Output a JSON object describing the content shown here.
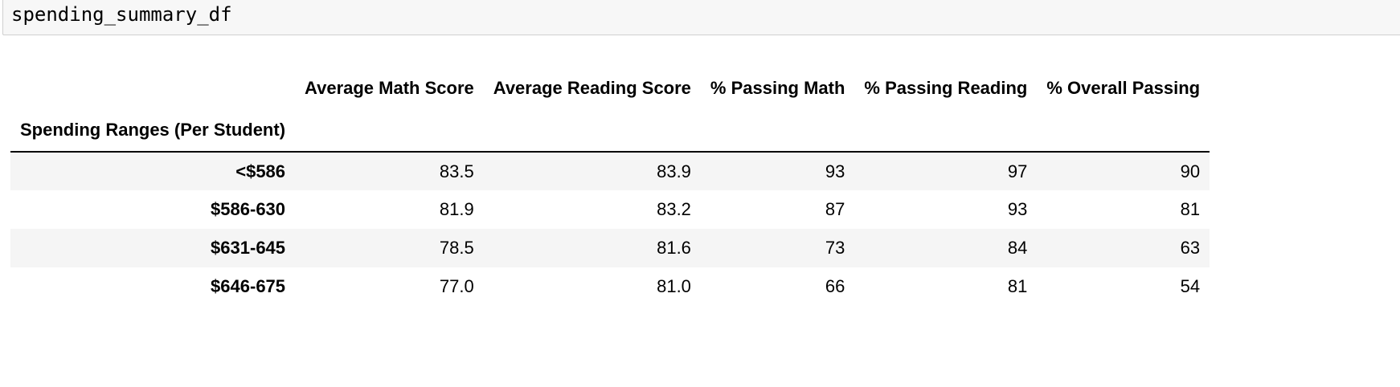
{
  "code_cell": {
    "source": "spending_summary_df"
  },
  "dataframe": {
    "columns": [
      "Average Math Score",
      "Average Reading Score",
      "% Passing Math",
      "% Passing Reading",
      "% Overall Passing"
    ],
    "index_name": "Spending Ranges (Per Student)",
    "rows": [
      {
        "index": "<$586",
        "values": [
          "83.5",
          "83.9",
          "93",
          "97",
          "90"
        ]
      },
      {
        "index": "$586-630",
        "values": [
          "81.9",
          "83.2",
          "87",
          "93",
          "81"
        ]
      },
      {
        "index": "$631-645",
        "values": [
          "78.5",
          "81.6",
          "73",
          "84",
          "63"
        ]
      },
      {
        "index": "$646-675",
        "values": [
          "77.0",
          "81.0",
          "66",
          "81",
          "54"
        ]
      }
    ]
  }
}
